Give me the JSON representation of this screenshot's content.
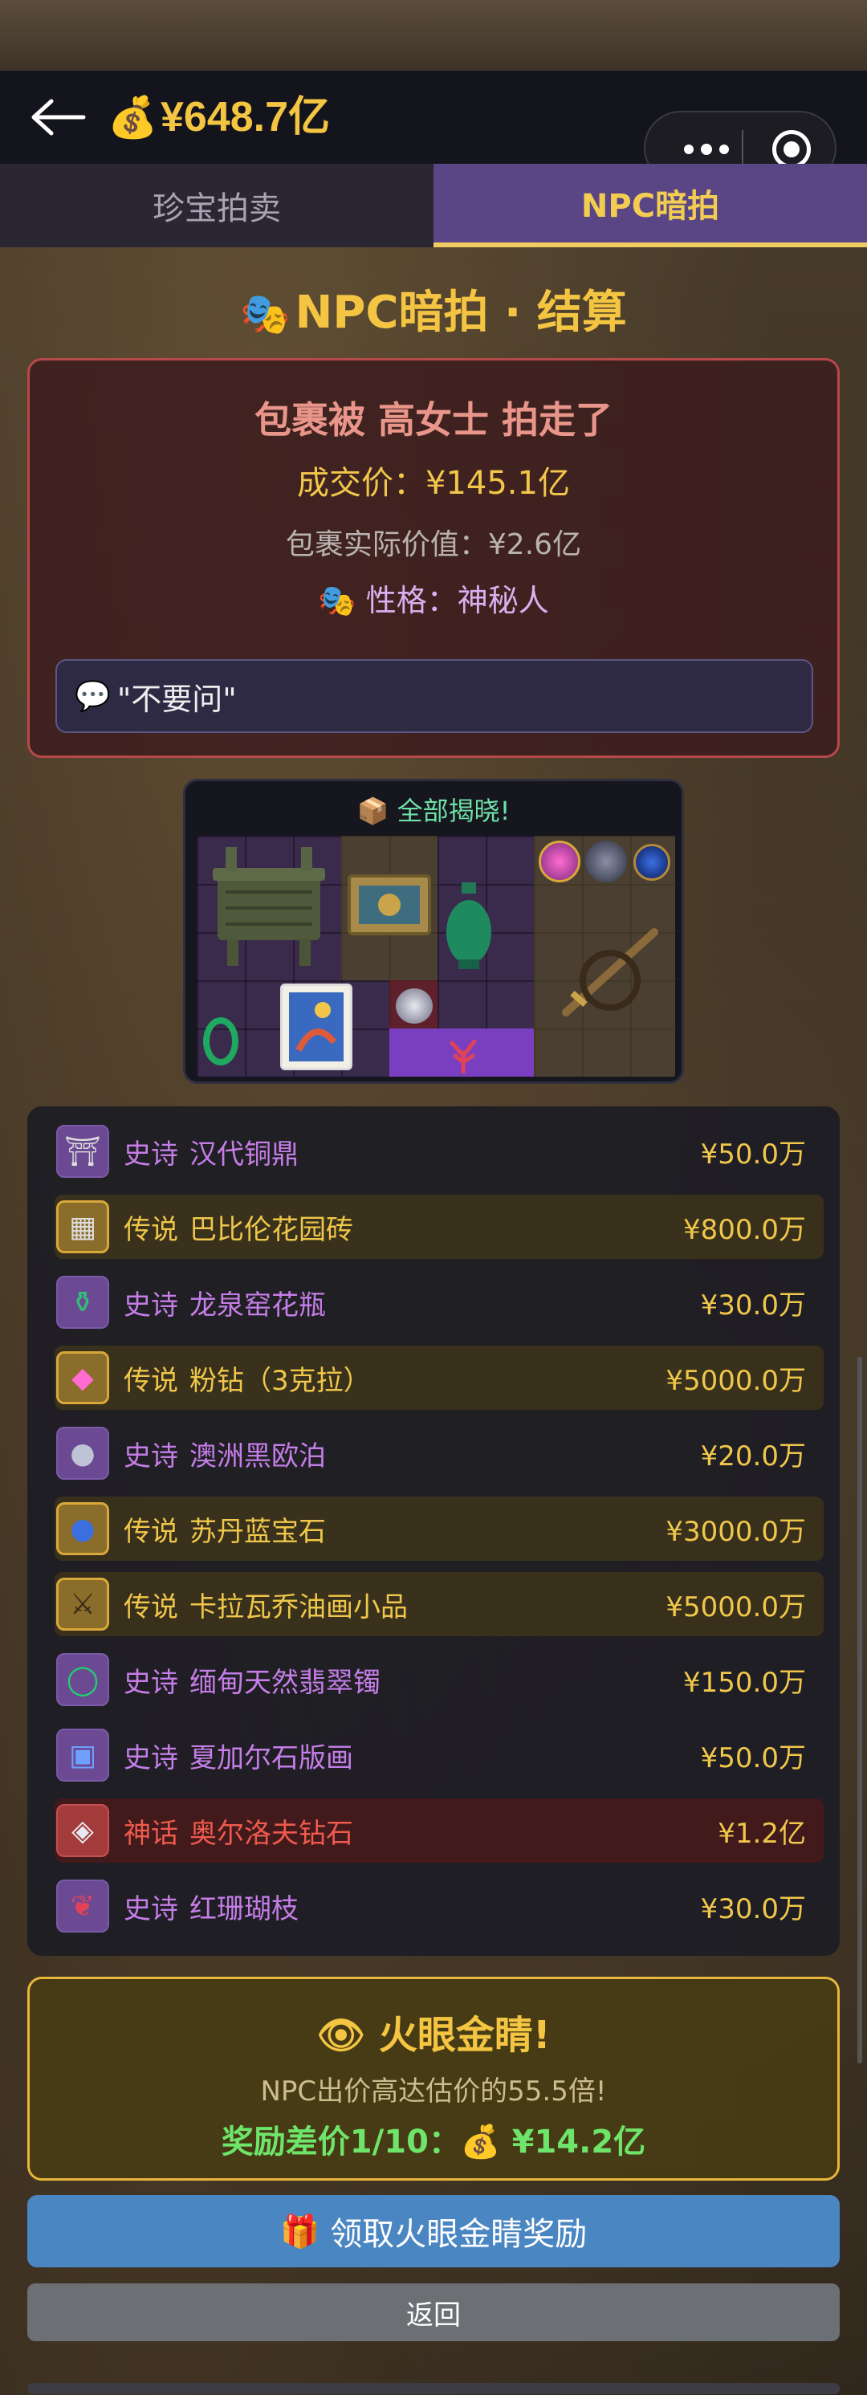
{
  "header": {
    "balance_icon": "money-bag-icon",
    "balance": "¥648.7亿"
  },
  "tabs": [
    {
      "label": "珍宝拍卖",
      "active": false
    },
    {
      "label": "NPC暗拍",
      "active": true
    }
  ],
  "section": {
    "title": "NPC暗拍 · 结算"
  },
  "result": {
    "headline": "包裹被 高女士 拍走了",
    "deal_price": "成交价：¥145.1亿",
    "actual_value": "包裹实际价值：¥2.6亿",
    "personality": "性格：神秘人",
    "quote": "\"不要问\""
  },
  "reveal": {
    "title": "全部揭晓!"
  },
  "items": [
    {
      "rarity": "史诗",
      "name": "汉代铜鼎",
      "price": "¥50.0万",
      "tier": "epic",
      "icon": "bronze-ding-icon"
    },
    {
      "rarity": "传说",
      "name": "巴比伦花园砖",
      "price": "¥800.0万",
      "tier": "legend",
      "icon": "babylon-brick-icon"
    },
    {
      "rarity": "史诗",
      "name": "龙泉窑花瓶",
      "price": "¥30.0万",
      "tier": "epic",
      "icon": "celadon-vase-icon"
    },
    {
      "rarity": "传说",
      "name": "粉钻（3克拉）",
      "price": "¥5000.0万",
      "tier": "legend",
      "icon": "pink-diamond-icon"
    },
    {
      "rarity": "史诗",
      "name": "澳洲黑欧泊",
      "price": "¥20.0万",
      "tier": "epic",
      "icon": "black-opal-icon"
    },
    {
      "rarity": "传说",
      "name": "苏丹蓝宝石",
      "price": "¥3000.0万",
      "tier": "legend",
      "icon": "sapphire-icon"
    },
    {
      "rarity": "传说",
      "name": "卡拉瓦乔油画小品",
      "price": "¥5000.0万",
      "tier": "legend",
      "icon": "caravaggio-painting-icon"
    },
    {
      "rarity": "史诗",
      "name": "缅甸天然翡翠镯",
      "price": "¥150.0万",
      "tier": "epic",
      "icon": "jade-bangle-icon"
    },
    {
      "rarity": "史诗",
      "name": "夏加尔石版画",
      "price": "¥50.0万",
      "tier": "epic",
      "icon": "chagall-lithograph-icon"
    },
    {
      "rarity": "神话",
      "name": "奥尔洛夫钻石",
      "price": "¥1.2亿",
      "tier": "myth",
      "icon": "orlov-diamond-icon"
    },
    {
      "rarity": "史诗",
      "name": "红珊瑚枝",
      "price": "¥30.0万",
      "tier": "epic",
      "icon": "red-coral-icon"
    }
  ],
  "reward": {
    "title": "火眼金睛!",
    "subtitle": "NPC出价高达估价的55.5倍!",
    "bonus": "奖励差价1/10：💰 ¥14.2亿"
  },
  "buttons": {
    "claim": "领取火眼金睛奖励",
    "back": "返回"
  },
  "colors": {
    "gold": "#f4c542",
    "epic": "#c57ee8",
    "legend": "#f0c74a",
    "myth": "#ef5a4d",
    "active_tab": "#5a4685",
    "claim_button": "#4a86c2"
  }
}
